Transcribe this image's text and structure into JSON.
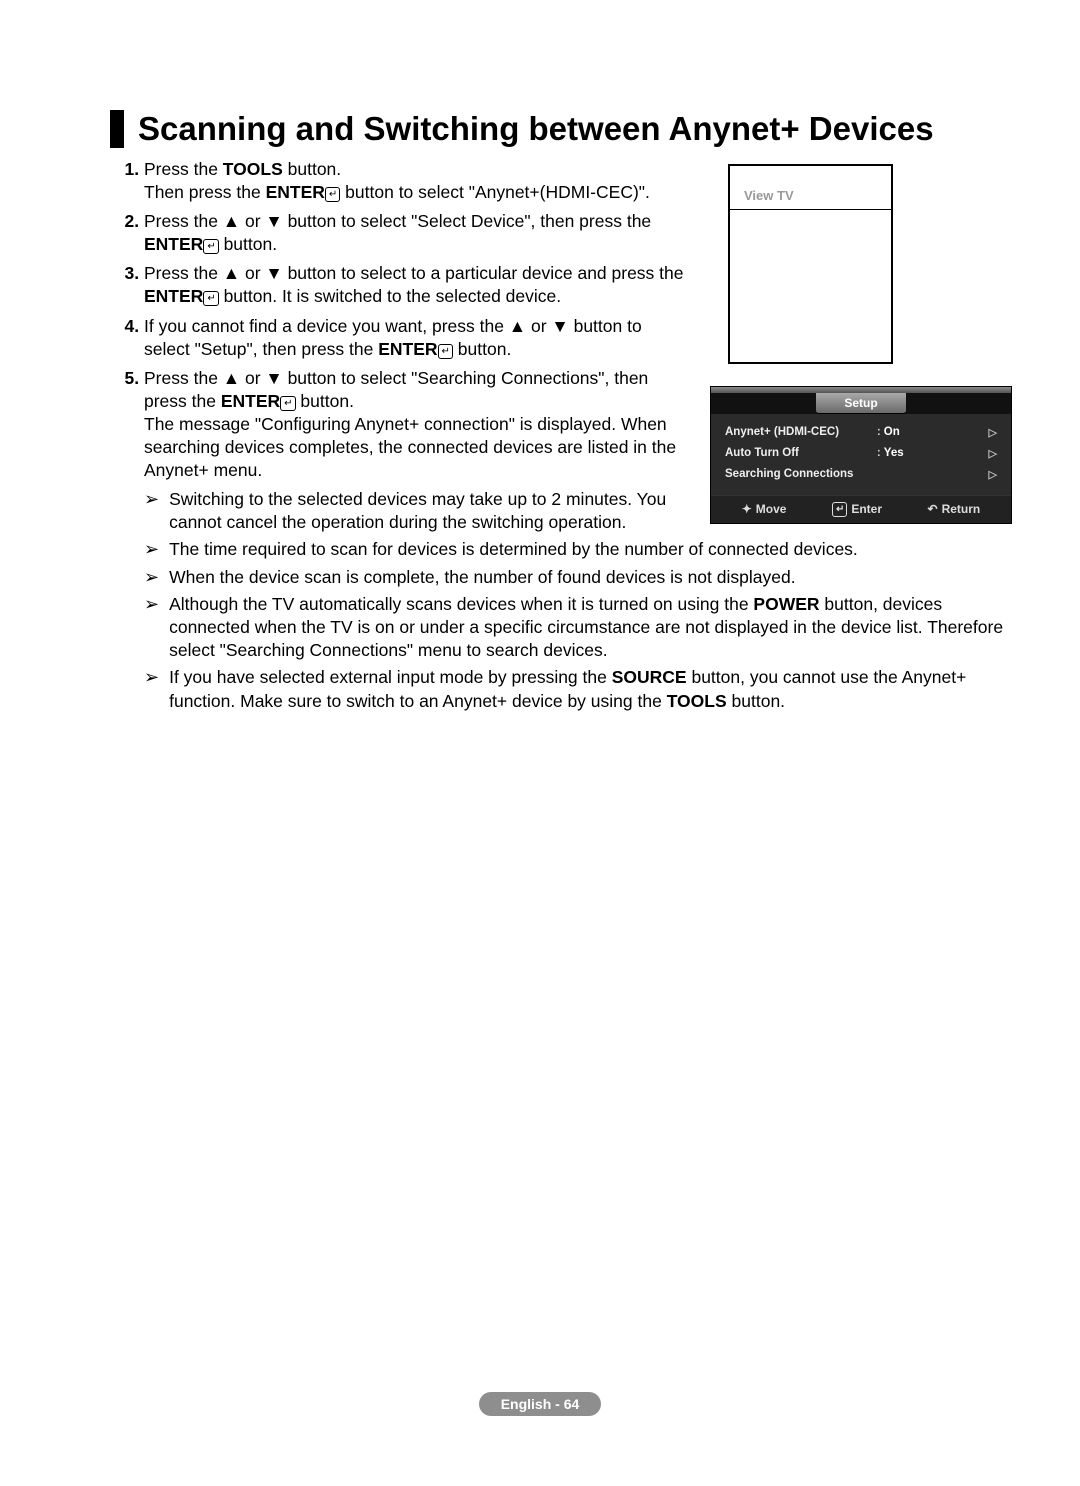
{
  "title": "Scanning and Switching between Anynet+ Devices",
  "steps": {
    "s1a": "Press the ",
    "s1b": "TOOLS",
    "s1c": " button.",
    "s1d": "Then press the ",
    "s1e": "ENTER",
    "s1f": " button to select \"Anynet+(HDMI-CEC)\".",
    "s2a": "Press the ▲ or ▼ button to select \"Select Device\", then press the ",
    "s2b": "ENTER",
    "s2c": " button.",
    "s3a": "Press the ▲ or ▼ button to select to a particular device and press the ",
    "s3b": "ENTER",
    "s3c": " button. It is switched to the selected device.",
    "s4a": "If you cannot find a device you want, press the ▲ or ▼ button to select \"Setup\", then press the ",
    "s4b": "ENTER",
    "s4c": " button.",
    "s5a": "Press the ▲ or ▼ button to select \"Searching Connections\", then press the ",
    "s5b": "ENTER",
    "s5c": " button.",
    "s5d": "The message \"Configuring Anynet+ connection\" is displayed. When searching devices completes, the connected devices are listed in the Anynet+ menu."
  },
  "notes": {
    "n1": "Switching to the selected devices may take up to 2 minutes. You cannot cancel the operation during the switching operation.",
    "n2": "The time required to scan for devices is determined by the number of connected devices.",
    "n3": "When the device scan is complete, the number of found devices is not displayed.",
    "n4a": "Although the TV automatically scans devices when it is turned on using the ",
    "n4b": "POWER",
    "n4c": " button, devices connected when the TV is on or under a specific circumstance are not displayed in the device list. Therefore select \"Searching Connections\" menu to search devices.",
    "n5a": "If you have selected external input mode by pressing the ",
    "n5b": "SOURCE",
    "n5c": " button, you cannot use the Anynet+ function. Make sure to switch to an Anynet+ device by using the ",
    "n5d": "TOOLS",
    "n5e": " button."
  },
  "tv": {
    "viewtv": "View TV"
  },
  "osd": {
    "title": "Setup",
    "row1_label": "Anynet+ (HDMI-CEC)",
    "row1_val": "On",
    "row2_label": "Auto Turn Off",
    "row2_val": "Yes",
    "row3_label": "Searching Connections",
    "footer_move": "Move",
    "footer_enter": "Enter",
    "footer_return": "Return"
  },
  "footer": "English - 64",
  "arrow": "➢"
}
